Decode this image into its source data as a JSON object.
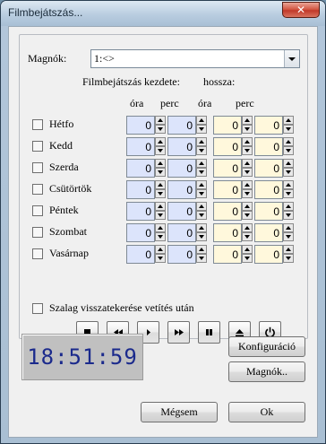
{
  "window": {
    "title": "Filmbejátszás..."
  },
  "magnok": {
    "label": "Magnók:",
    "value": "1:<>"
  },
  "headers": {
    "start": "Filmbejátszás kezdete:",
    "duration": "hossza:",
    "start_hour": "óra",
    "start_min": "perc",
    "dur_hour": "óra",
    "dur_min": "perc"
  },
  "days": [
    {
      "name": "Hétfo",
      "checked": false,
      "start_hour": "0",
      "start_min": "0",
      "dur_hour": "0",
      "dur_min": "0"
    },
    {
      "name": "Kedd",
      "checked": false,
      "start_hour": "0",
      "start_min": "0",
      "dur_hour": "0",
      "dur_min": "0"
    },
    {
      "name": "Szerda",
      "checked": false,
      "start_hour": "0",
      "start_min": "0",
      "dur_hour": "0",
      "dur_min": "0"
    },
    {
      "name": "Csütörtök",
      "checked": false,
      "start_hour": "0",
      "start_min": "0",
      "dur_hour": "0",
      "dur_min": "0"
    },
    {
      "name": "Péntek",
      "checked": false,
      "start_hour": "0",
      "start_min": "0",
      "dur_hour": "0",
      "dur_min": "0"
    },
    {
      "name": "Szombat",
      "checked": false,
      "start_hour": "0",
      "start_min": "0",
      "dur_hour": "0",
      "dur_min": "0"
    },
    {
      "name": "Vasárnap",
      "checked": false,
      "start_hour": "0",
      "start_min": "0",
      "dur_hour": "0",
      "dur_min": "0"
    }
  ],
  "rewind_option": {
    "label": "Szalag visszatekerése vetítés után",
    "checked": false
  },
  "transport": [
    "stop-icon",
    "rewind-icon",
    "play-icon",
    "fast-forward-icon",
    "pause-icon",
    "eject-icon",
    "power-icon"
  ],
  "clock": {
    "time": "18:51:59"
  },
  "buttons": {
    "config": "Konfiguráció",
    "magnok": "Magnók..",
    "cancel": "Mégsem",
    "ok": "Ok"
  },
  "colors": {
    "start_field": "#dce4fb",
    "duration_field": "#fff8dc",
    "clock_digits": "#1b2a8c"
  }
}
